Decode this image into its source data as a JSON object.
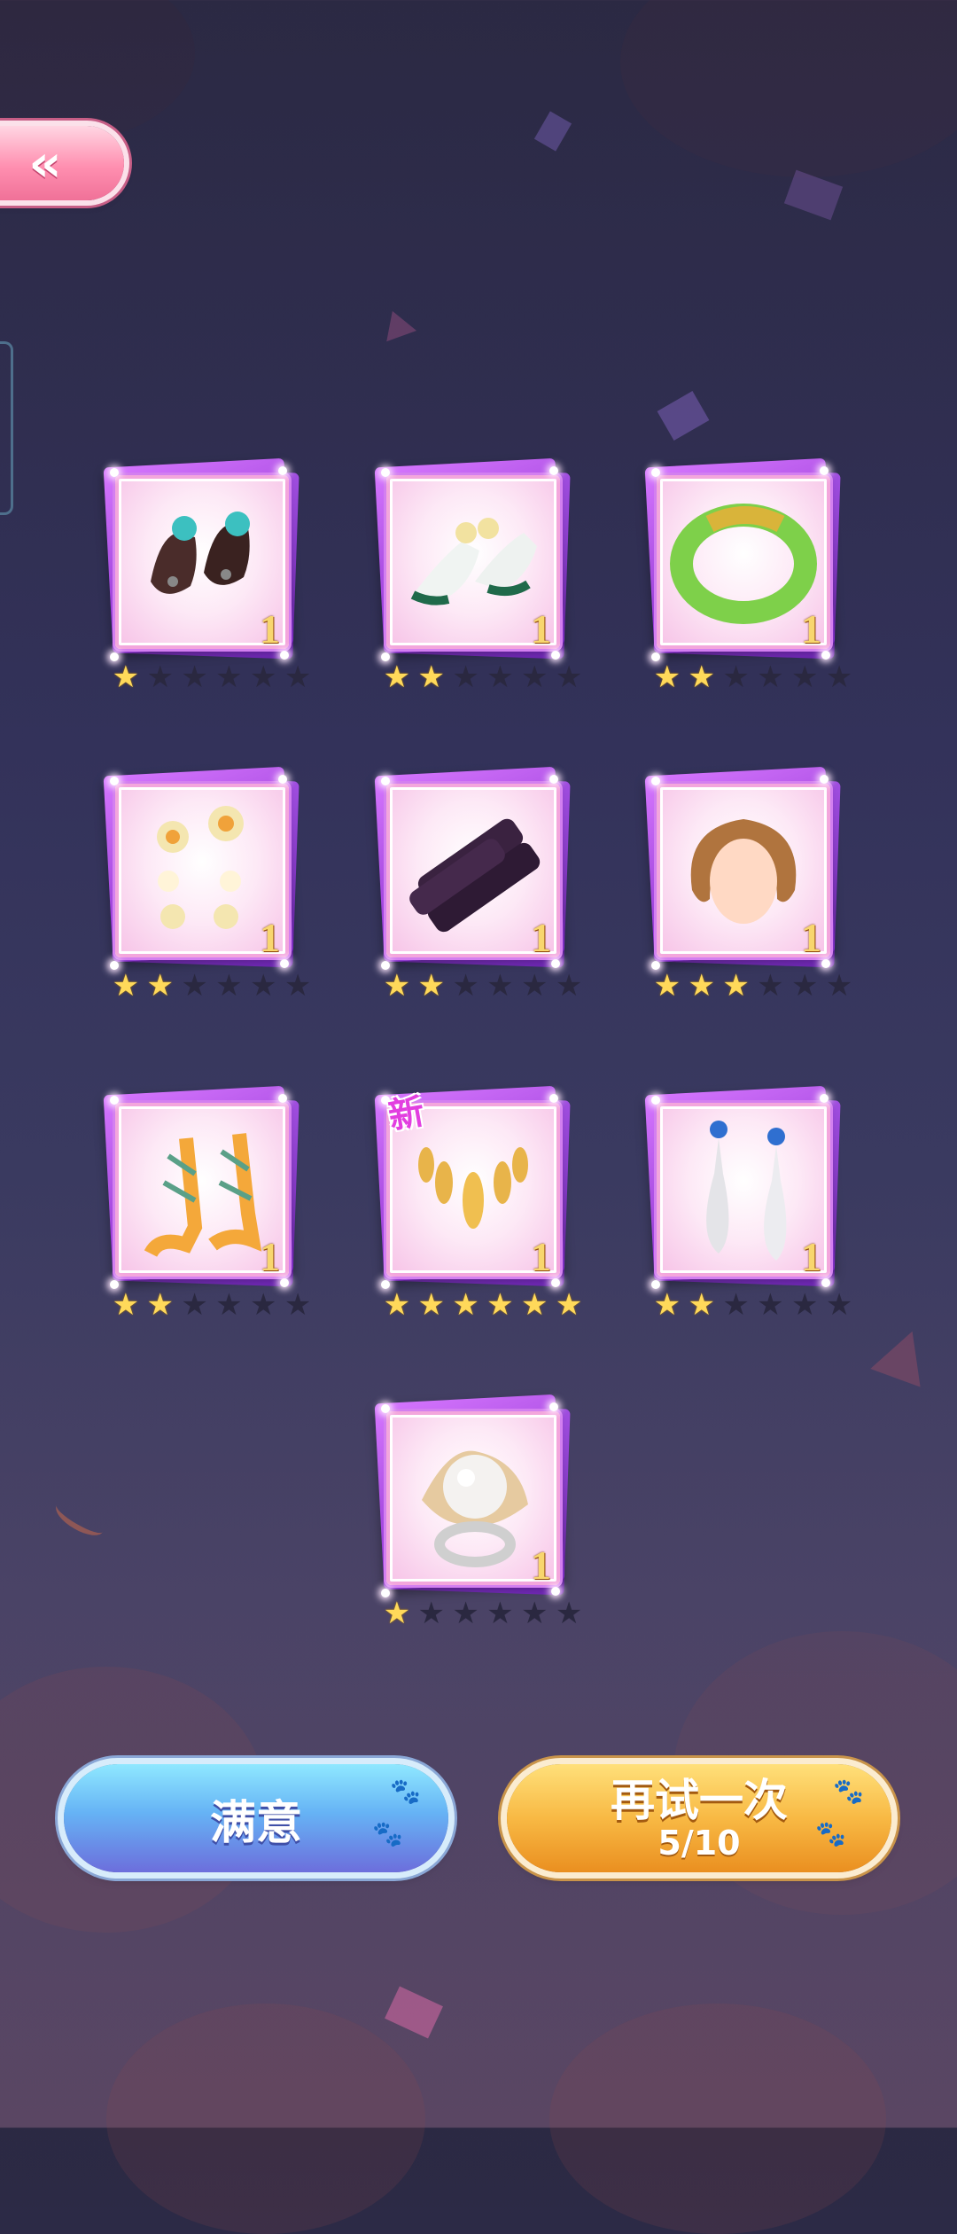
{
  "back_button": {
    "icon": "double-chevron-left-icon",
    "label": "«"
  },
  "items": [
    {
      "name": "brown-boots-icon",
      "quantity": "1",
      "stars": 1,
      "max_stars": 6,
      "is_new": false
    },
    {
      "name": "white-heels-icon",
      "quantity": "1",
      "stars": 2,
      "max_stars": 6,
      "is_new": false
    },
    {
      "name": "jade-bracelet-icon",
      "quantity": "1",
      "stars": 2,
      "max_stars": 6,
      "is_new": false
    },
    {
      "name": "flower-earrings-icon",
      "quantity": "1",
      "stars": 2,
      "max_stars": 6,
      "is_new": false
    },
    {
      "name": "dark-wood-sticks-icon",
      "quantity": "1",
      "stars": 2,
      "max_stars": 6,
      "is_new": false
    },
    {
      "name": "wavy-hair-icon",
      "quantity": "1",
      "stars": 3,
      "max_stars": 6,
      "is_new": false
    },
    {
      "name": "lace-up-sandals-icon",
      "quantity": "1",
      "stars": 2,
      "max_stars": 6,
      "is_new": false
    },
    {
      "name": "gold-necklace-icon",
      "quantity": "1",
      "stars": 6,
      "max_stars": 6,
      "is_new": true,
      "new_label": "新"
    },
    {
      "name": "pearl-drop-earrings-icon",
      "quantity": "1",
      "stars": 2,
      "max_stars": 6,
      "is_new": false
    },
    {
      "name": "pearl-ring-icon",
      "quantity": "1",
      "stars": 1,
      "max_stars": 6,
      "is_new": false
    }
  ],
  "buttons": {
    "satisfied_label": "满意",
    "retry_label": "再试一次",
    "retry_count": "5/10"
  },
  "colors": {
    "star_on": "#ffd95a",
    "star_off": "#2a2840",
    "card_border": "#d37ff0",
    "quantity_text": "#f8d66e"
  }
}
